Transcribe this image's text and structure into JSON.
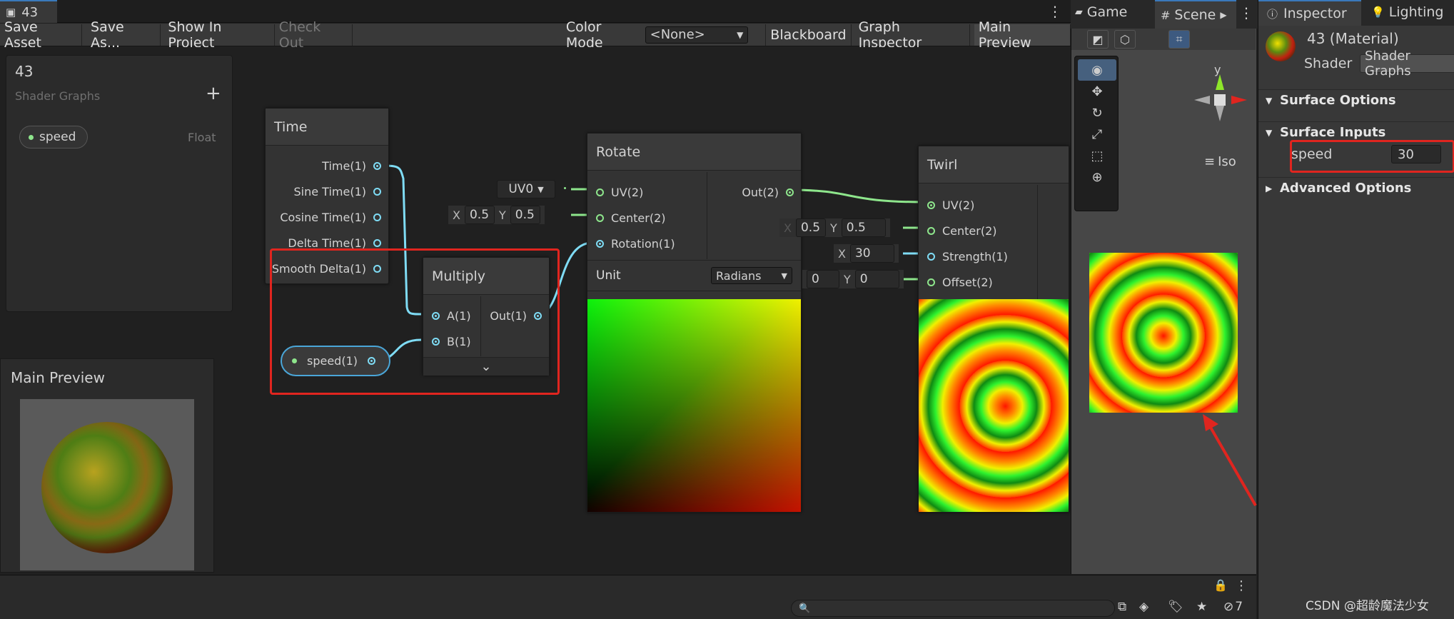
{
  "graph_tab": {
    "title": "43"
  },
  "toolbar": {
    "save_asset": "Save Asset",
    "save_as": "Save As...",
    "show_in_project": "Show In Project",
    "check_out": "Check Out",
    "color_mode_label": "Color Mode",
    "color_mode_value": "<None>",
    "blackboard": "Blackboard",
    "graph_inspector": "Graph Inspector",
    "main_preview": "Main Preview"
  },
  "blackboard": {
    "title": "43",
    "subtitle": "Shader Graphs",
    "add": "+",
    "property_name": "speed",
    "property_type": "Float"
  },
  "main_preview": {
    "title": "Main Preview"
  },
  "nodes": {
    "time": {
      "title": "Time",
      "outputs": [
        "Time(1)",
        "Sine Time(1)",
        "Cosine Time(1)",
        "Delta Time(1)",
        "Smooth Delta(1)"
      ]
    },
    "speed_prop": {
      "label": "speed(1)"
    },
    "multiply": {
      "title": "Multiply",
      "in_a": "A(1)",
      "in_b": "B(1)",
      "out": "Out(1)",
      "expand": "⌄"
    },
    "rotate": {
      "title": "Rotate",
      "in_uv": "UV(2)",
      "in_center": "Center(2)",
      "in_rotation": "Rotation(1)",
      "out": "Out(2)",
      "unit_label": "Unit",
      "unit_value": "Radians",
      "uv_value": "UV0",
      "center_x_label": "X",
      "center_x": "0.5",
      "center_y_label": "Y",
      "center_y": "0.5"
    },
    "twirl": {
      "title": "Twirl",
      "in_uv": "UV(2)",
      "in_center": "Center(2)",
      "in_strength": "Strength(1)",
      "in_offset": "Offset(2)",
      "center_x_label": "X",
      "center_x": "0.5",
      "center_y_label": "Y",
      "center_y": "0.5",
      "strength_label": "X",
      "strength": "30",
      "offset_x": "0",
      "offset_y_label": "Y",
      "offset_y": "0"
    }
  },
  "scene": {
    "tab_game": "Game",
    "tab_scene": "Scene",
    "axis_y": "y",
    "iso": "Iso"
  },
  "inspector": {
    "tab_inspector": "Inspector",
    "tab_lighting": "Lighting",
    "material_name": "43 (Material)",
    "shader_label": "Shader",
    "shader_value": "Shader Graphs",
    "surface_options": "Surface Options",
    "surface_inputs": "Surface Inputs",
    "speed_label": "speed",
    "speed_value": "30",
    "advanced_options": "Advanced Options"
  },
  "status": {
    "layers_count": "7"
  },
  "watermark": "CSDN @超龄魔法少女",
  "colors": {
    "wire_float": "#7fdcf5",
    "wire_vector": "#8ee68c",
    "highlight": "#e0251f",
    "accent": "#3a79bb"
  }
}
